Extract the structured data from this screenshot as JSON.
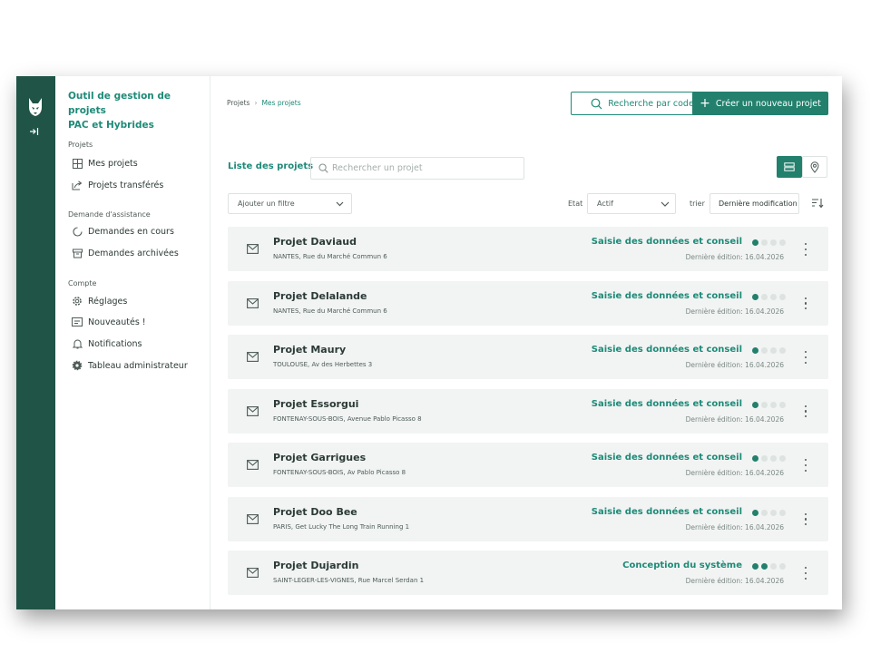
{
  "app": {
    "title_line1": "Outil de gestion de projets",
    "title_line2": "PAC et Hybrides"
  },
  "sidebar": {
    "sections": [
      {
        "label": "Projets",
        "items": [
          {
            "label": "Mes projets",
            "icon": "grid-icon"
          },
          {
            "label": "Projets transférés",
            "icon": "share-icon"
          }
        ]
      },
      {
        "label": "Demande d'assistance",
        "items": [
          {
            "label": "Demandes en cours",
            "icon": "loading-icon"
          },
          {
            "label": "Demandes archivées",
            "icon": "archive-icon"
          }
        ]
      },
      {
        "label": "Compte",
        "items": [
          {
            "label": "Réglages",
            "icon": "gear-icon"
          },
          {
            "label": "Nouveautés !",
            "icon": "news-icon"
          },
          {
            "label": "Notifications",
            "icon": "bell-icon"
          },
          {
            "label": "Tableau administrateur",
            "icon": "cog-filled-icon"
          }
        ]
      }
    ]
  },
  "header": {
    "breadcrumb": [
      "Projets",
      "Mes projets"
    ],
    "search_code_label": "Recherche par code",
    "create_label": "Créer un nouveau projet"
  },
  "list": {
    "title": "Liste des projets",
    "search_placeholder": "Rechercher un projet",
    "filter_label": "Ajouter un filtre",
    "etat_label": "Etat",
    "etat_value": "Actif",
    "sort_label": "trier",
    "sort_value": "Dernière modification"
  },
  "projects": [
    {
      "name": "Projet Daviaud",
      "address": "NANTES, Rue du Marché Commun 6",
      "status": "Saisie des données et conseil",
      "step": 1,
      "steps": 4,
      "edited": "Dernière édition: 16.04.2026"
    },
    {
      "name": "Projet Delalande",
      "address": "NANTES, Rue du Marché Commun 6",
      "status": "Saisie des données et conseil",
      "step": 1,
      "steps": 4,
      "edited": "Dernière édition: 16.04.2026"
    },
    {
      "name": "Projet Maury",
      "address": "TOULOUSE, Av des Herbettes 3",
      "status": "Saisie des données et conseil",
      "step": 1,
      "steps": 4,
      "edited": "Dernière édition: 16.04.2026"
    },
    {
      "name": "Projet Essorgui",
      "address": "FONTENAY-SOUS-BOIS, Avenue Pablo Picasso 8",
      "status": "Saisie des données et conseil",
      "step": 1,
      "steps": 4,
      "edited": "Dernière édition: 16.04.2026"
    },
    {
      "name": "Projet Garrigues",
      "address": "FONTENAY-SOUS-BOIS, Av Pablo Picasso 8",
      "status": "Saisie des données et conseil",
      "step": 1,
      "steps": 4,
      "edited": "Dernière édition: 16.04.2026"
    },
    {
      "name": "Projet Doo Bee",
      "address": "PARIS, Get Lucky The Long Train Running 1",
      "status": "Saisie des données et conseil",
      "step": 1,
      "steps": 4,
      "edited": "Dernière édition: 16.04.2026"
    },
    {
      "name": "Projet Dujardin",
      "address": "SAINT-LEGER-LES-VIGNES, Rue Marcel Serdan 1",
      "status": "Conception du système",
      "step": 2,
      "steps": 4,
      "edited": "Dernière édition: 16.04.2026"
    }
  ],
  "colors": {
    "brand_dark": "#1f5446",
    "accent": "#1e8a78",
    "button": "#23806d",
    "dot_active": "#23806d",
    "dot_inactive": "#dde3e1",
    "row_bg": "#f1f4f3"
  }
}
